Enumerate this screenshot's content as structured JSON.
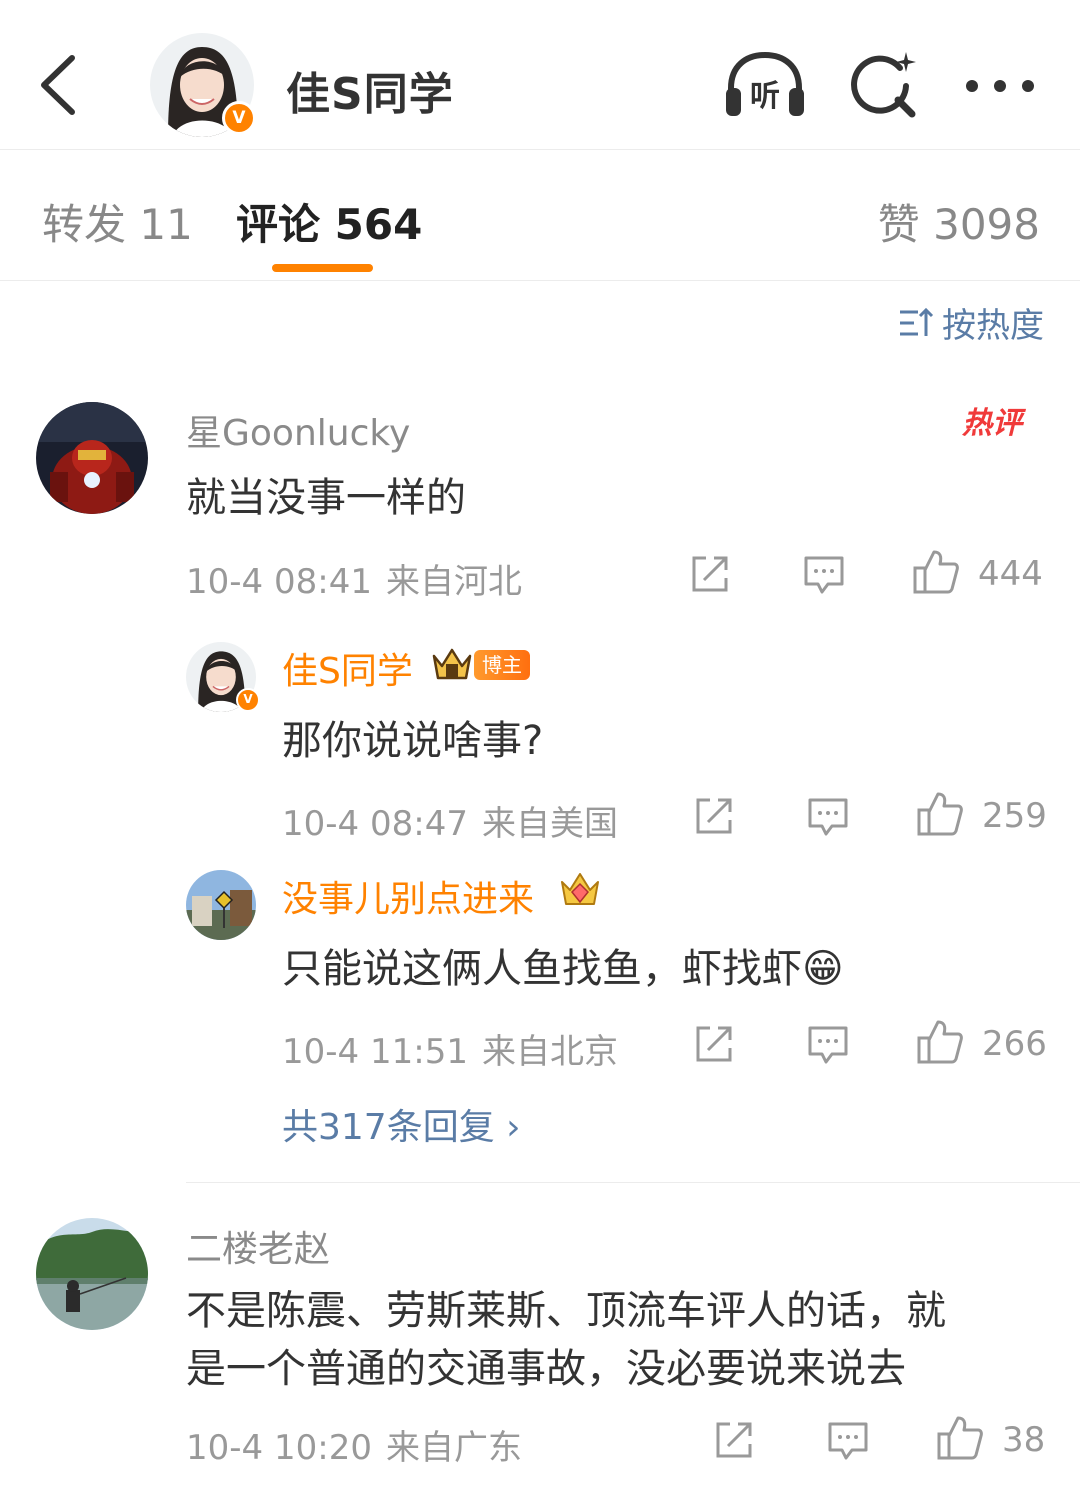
{
  "header": {
    "name": "佳S同学",
    "verified_badge": "V",
    "listen_label": "听",
    "icons": [
      "back-icon",
      "listen-icon",
      "search-icon",
      "more-icon"
    ]
  },
  "tabs": {
    "repost": "转发 11",
    "comment": "评论 564",
    "like": "赞 3098",
    "active": "comment",
    "accent_color": "#ff8200"
  },
  "sort": {
    "label": "按热度",
    "icon": "sort-icon",
    "color": "#5a7ca6"
  },
  "comments": [
    {
      "user": "星Goonlucky",
      "hot_label": "热评",
      "text": "就当没事一样的",
      "time": "10-4 08:41",
      "location": "来自河北",
      "likes": "444",
      "replies": [
        {
          "user": "佳S同学",
          "badge": "博主",
          "text": "那你说说啥事?",
          "time": "10-4 08:47",
          "location": "来自美国",
          "likes": "259"
        },
        {
          "user": "没事儿别点进来",
          "text": "只能说这俩人鱼找鱼，虾找虾",
          "emoji": "😁",
          "time": "10-4 11:51",
          "location": "来自北京",
          "likes": "266"
        }
      ],
      "more_replies": "共317条回复 ›"
    },
    {
      "user": "二楼老赵",
      "text_line1": "不是陈震、劳斯莱斯、顶流车评人的话，就",
      "text_line2": "是一个普通的交通事故，没必要说来说去",
      "time": "10-4 10:20",
      "location": "来自广东",
      "likes": "38"
    }
  ]
}
